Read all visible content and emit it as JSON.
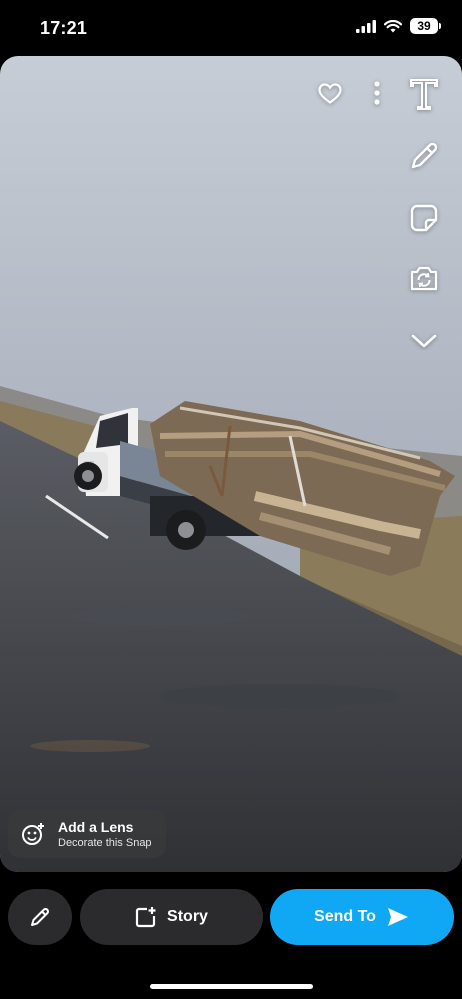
{
  "status_bar": {
    "time": "17:21",
    "battery": "39"
  },
  "snap_tools": {
    "icons": [
      "heart-icon",
      "more-vertical-icon",
      "text-icon",
      "pencil-icon",
      "sticker-icon",
      "camera-switch-icon",
      "chevron-down-icon"
    ]
  },
  "lens": {
    "title": "Add a Lens",
    "subtitle": "Decorate this Snap"
  },
  "bottom": {
    "story_label": "Story",
    "send_label": "Send To"
  },
  "colors": {
    "send_blue": "#10a8f5",
    "pill_dark": "#2b2b2d",
    "lens_chip": "#3c3c3c"
  }
}
